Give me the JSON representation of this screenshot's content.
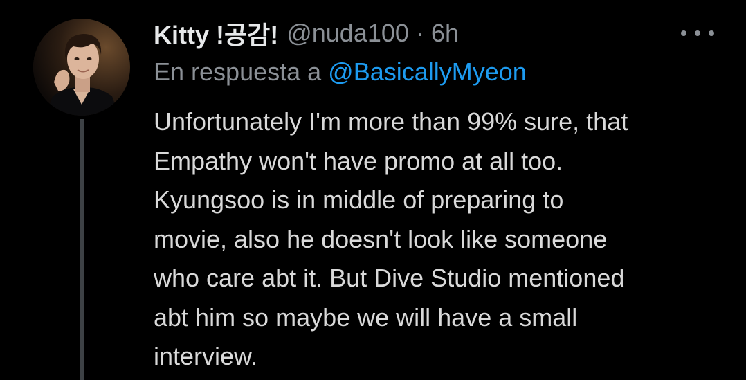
{
  "tweet": {
    "display_name": "Kitty !공감!",
    "handle": "@nuda100",
    "separator": "·",
    "time": "6h",
    "reply_prefix": "En respuesta a",
    "reply_to": "@BasicallyMyeon",
    "text_lines": [
      "Unfortunately I'm more than 99% sure, that",
      "Empathy won't have promo at all too.",
      "Kyungsoo is in middle of preparing to",
      "movie, also he doesn't look like someone",
      "who care abt it. But Dive Studio mentioned",
      "abt him so maybe we will have a small",
      "interview."
    ],
    "more_icon": "more-horizontal-icon"
  },
  "colors": {
    "background": "#000000",
    "primary_text": "#e7e9ea",
    "secondary_text": "#8b9096",
    "link": "#1d9bf0",
    "thread_line": "#3d4145"
  }
}
